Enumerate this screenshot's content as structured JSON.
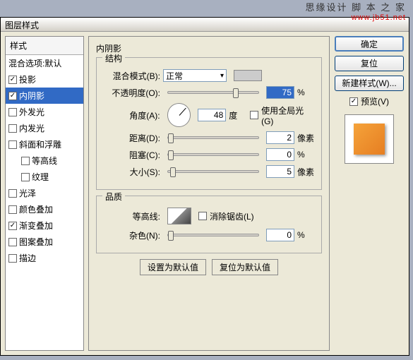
{
  "watermark": {
    "line1": "思缘设计 脚 本 之 家",
    "line2": "www.jb51.net"
  },
  "title": "图层样式",
  "left": {
    "header": "样式",
    "top": "混合选项:默认",
    "items": [
      {
        "label": "投影",
        "checked": true,
        "selected": false
      },
      {
        "label": "内阴影",
        "checked": true,
        "selected": true
      },
      {
        "label": "外发光",
        "checked": false
      },
      {
        "label": "内发光",
        "checked": false
      },
      {
        "label": "斜面和浮雕",
        "checked": false
      },
      {
        "label": "等高线",
        "checked": false,
        "sub": true
      },
      {
        "label": "纹理",
        "checked": false,
        "sub": true
      },
      {
        "label": "光泽",
        "checked": false
      },
      {
        "label": "颜色叠加",
        "checked": false
      },
      {
        "label": "渐变叠加",
        "checked": true
      },
      {
        "label": "图案叠加",
        "checked": false
      },
      {
        "label": "描边",
        "checked": false
      }
    ]
  },
  "mid": {
    "panel_title": "内阴影",
    "structure": {
      "legend": "结构",
      "blend_label": "混合模式(B):",
      "blend_value": "正常",
      "opacity_label": "不透明度(O):",
      "opacity_value": "75",
      "opacity_unit": "%",
      "angle_label": "角度(A):",
      "angle_value": "48",
      "angle_unit": "度",
      "global_light": "使用全局光(G)",
      "distance_label": "距离(D):",
      "distance_value": "2",
      "distance_unit": "像素",
      "choke_label": "阻塞(C):",
      "choke_value": "0",
      "choke_unit": "%",
      "size_label": "大小(S):",
      "size_value": "5",
      "size_unit": "像素"
    },
    "quality": {
      "legend": "品质",
      "contour_label": "等高线:",
      "anti_alias": "消除锯齿(L)",
      "noise_label": "杂色(N):",
      "noise_value": "0",
      "noise_unit": "%"
    },
    "btn_default": "设置为默认值",
    "btn_reset": "复位为默认值"
  },
  "right": {
    "ok": "确定",
    "cancel": "复位",
    "new_style": "新建样式(W)...",
    "preview": "预览(V)"
  }
}
